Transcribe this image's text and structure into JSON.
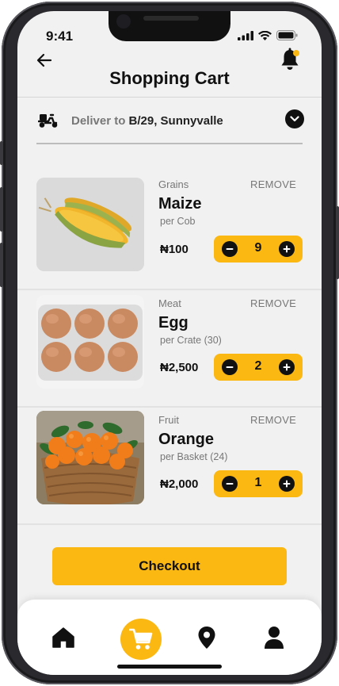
{
  "status": {
    "time": "9:41"
  },
  "header": {
    "title": "Shopping Cart"
  },
  "delivery": {
    "prefix": "Deliver to",
    "address": "B/29, Sunnyvalle"
  },
  "items": [
    {
      "category": "Grains",
      "remove_label": "REMOVE",
      "name": "Maize",
      "unit": "per Cob",
      "price": "₦100",
      "quantity": "9"
    },
    {
      "category": "Meat",
      "remove_label": "REMOVE",
      "name": "Egg",
      "unit": "per Crate (30)",
      "price": "₦2,500",
      "quantity": "2"
    },
    {
      "category": "Fruit",
      "remove_label": "REMOVE",
      "name": "Orange",
      "unit": "per Basket (24)",
      "price": "₦2,000",
      "quantity": "1"
    }
  ],
  "checkout": {
    "label": "Checkout"
  },
  "nav": {
    "items": [
      "home-icon",
      "cart-icon",
      "location-pin-icon",
      "person-icon"
    ],
    "active": "cart-icon"
  },
  "colors": {
    "accent": "#fbb813",
    "background": "#f1f1f1",
    "text": "#111111",
    "muted": "#777777"
  }
}
